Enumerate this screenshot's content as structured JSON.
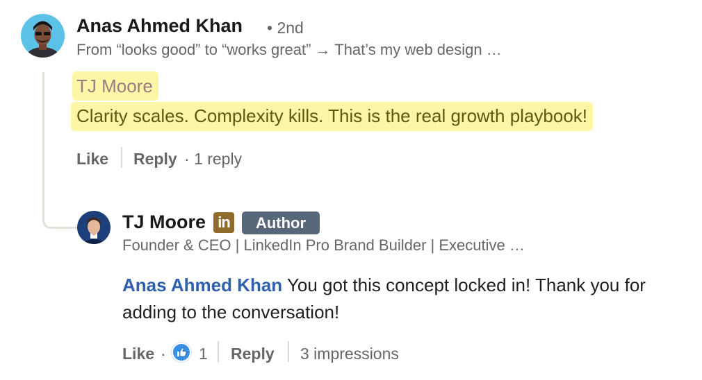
{
  "top_comment": {
    "author": "Anas Ahmed Khan",
    "degree": "• 2nd",
    "headline": "From “looks good” to “works great” → That’s my web design …",
    "quote_name": "TJ Moore",
    "quote_text": "Clarity scales. Complexity kills. This is the real growth playbook!",
    "like_label": "Like",
    "reply_label": "Reply",
    "reply_count": "· 1 reply"
  },
  "reply": {
    "author": "TJ Moore",
    "linkedin_badge": "in",
    "author_badge": "Author",
    "headline": "Founder & CEO | LinkedIn Pro Brand Builder | Executive …",
    "mention": "Anas Ahmed Khan",
    "text": " You got this concept locked in! Thank you for adding to the conversation!",
    "like_label": "Like",
    "like_dot": "·",
    "reaction_count": "1",
    "reply_label": "Reply",
    "impressions": "3 impressions"
  },
  "colors": {
    "highlight": "#fdf6a6",
    "mention": "#2e5fad",
    "author_badge": "#56687a",
    "linkedin_badge": "#8f6b2c",
    "like_reaction": "#378fe9"
  }
}
